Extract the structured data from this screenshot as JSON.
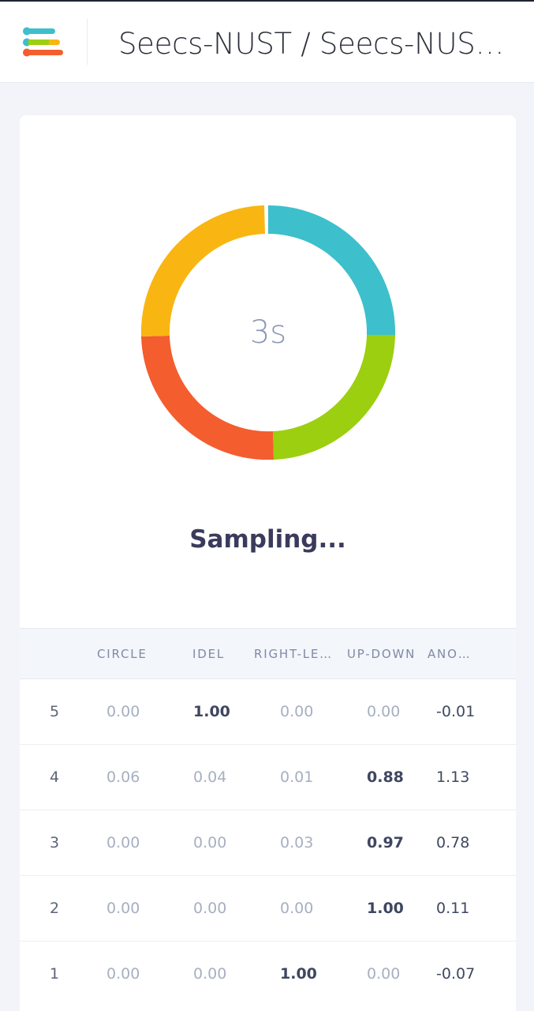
{
  "header": {
    "title": "Seecs-NUST / Seecs-NUS…",
    "logo_icon": "menu-stack-icon"
  },
  "progress": {
    "timer": "3s",
    "status": "Sampling...",
    "ring_colors": [
      "#3dbfcc",
      "#9ccf0f",
      "#f45d2e",
      "#f9b612"
    ]
  },
  "table": {
    "columns": [
      "CIRCLE",
      "IDEL",
      "RIGHT-LE…",
      "UP-DOWN",
      "ANO…"
    ],
    "rows": [
      {
        "index": "5",
        "values": [
          "0.00",
          "1.00",
          "0.00",
          "0.00",
          "-0.01"
        ]
      },
      {
        "index": "4",
        "values": [
          "0.06",
          "0.04",
          "0.01",
          "0.88",
          "1.13"
        ]
      },
      {
        "index": "3",
        "values": [
          "0.00",
          "0.00",
          "0.03",
          "0.97",
          "0.78"
        ]
      },
      {
        "index": "2",
        "values": [
          "0.00",
          "0.00",
          "0.00",
          "1.00",
          "0.11"
        ]
      },
      {
        "index": "1",
        "values": [
          "0.00",
          "0.00",
          "1.00",
          "0.00",
          "-0.07"
        ]
      }
    ]
  }
}
